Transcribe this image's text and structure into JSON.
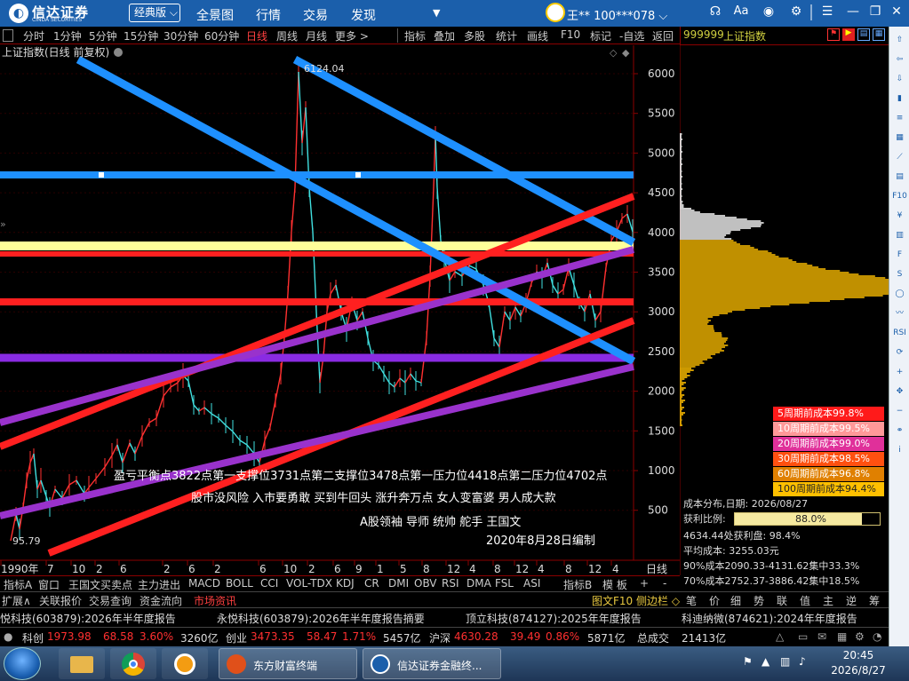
{
  "app": {
    "logo_text": "信达证券",
    "logo_en": "CINDA SECURITIES",
    "edition": "经典版",
    "menu": [
      "全景图",
      "行情",
      "交易",
      "发现"
    ],
    "user": "王** 100***078",
    "window_icons": [
      "headset-icon",
      "font-size-icon",
      "skin-icon",
      "settings-icon",
      "minimize-icon",
      "restore-icon",
      "close-icon"
    ]
  },
  "toolbar": {
    "periods": [
      "分时",
      "1分钟",
      "5分钟",
      "15分钟",
      "30分钟",
      "60分钟",
      "日线",
      "周线",
      "月线",
      "更多 >"
    ],
    "active_period": "日线",
    "tools": [
      "指标",
      "叠加",
      "多股",
      "统计",
      "画线",
      "F10",
      "标记",
      "-自选",
      "返回"
    ],
    "security_code": "999999",
    "security_name": "上证指数"
  },
  "chart": {
    "title": "上证指数(日线 前复权)",
    "high_label": "6124.04",
    "low_label": "95.79",
    "y_ticks": [
      500,
      1000,
      1500,
      2000,
      2500,
      3000,
      3500,
      4000,
      4500,
      5000,
      5500,
      6000
    ],
    "x_labels": [
      "1990年",
      "7",
      "10",
      "2",
      "6",
      "2",
      "6",
      "2",
      "6",
      "10",
      "2",
      "6",
      "9",
      "1",
      "5",
      "8",
      "12",
      "4",
      "8",
      "12",
      "4",
      "8",
      "12",
      "4"
    ],
    "period_label": "日线",
    "annotations": [
      "盈亏平衡点3822点第一支撑位3731点第二支撑位3478点第一压力位4418点第二压力位4702点",
      "股市没风险 入市要勇敢 买到牛回头 涨升奔万点 女人变富婆 男人成大款",
      "A股领袖 导师 统帅 舵手 王国文",
      "2020年8月28日编制"
    ],
    "h_lines": [
      {
        "value": 4702,
        "color": "#1e90ff"
      },
      {
        "value": 3822,
        "color": "#ffff99"
      },
      {
        "value": 3731,
        "color": "#ff2020"
      },
      {
        "value": 3100,
        "color": "#ff2020"
      },
      {
        "value": 2380,
        "color": "#8a2be2"
      }
    ],
    "colors": {
      "up": "#ff3030",
      "down": "#40e0e0",
      "blue_line": "#1e90ff",
      "red_line": "#ff2020",
      "purple_line": "#9932cc"
    }
  },
  "chip": {
    "cost_rows": [
      {
        "label": "5周期前成本99.8%",
        "color": "#ff1a1a"
      },
      {
        "label": "10周期前成本99.5%",
        "color": "#ff9999"
      },
      {
        "label": "20周期前成本99.0%",
        "color": "#e0309a"
      },
      {
        "label": "30周期前成本98.5%",
        "color": "#ff5010"
      },
      {
        "label": "60周期前成本96.8%",
        "color": "#e08000"
      },
      {
        "label": "100周期前成本94.4%",
        "color": "#ffc000"
      }
    ],
    "dist_date": "成本分布,日期:  2026/08/27",
    "profit_ratio_label": "获利比例:",
    "profit_ratio": "88.0%",
    "profit_ratio_fraction": 0.88,
    "profit_at": "4634.44处获利盘: 98.4%",
    "avg_cost": "平均成本:  3255.03元",
    "cost90": "90%成本2090.33-4131.62集中33.3%",
    "cost70": "70%成本2752.37-3886.42集中18.5%"
  },
  "indicators": [
    "指标A",
    "窗口",
    "王国文买卖点",
    "主力进出",
    "MACD",
    "BOLL",
    "CCI",
    "VOL-TDX",
    "KDJ",
    "CR",
    "DMI",
    "OBV",
    "RSI",
    "DMA",
    "FSL",
    "ASI",
    "指标B",
    "模 板",
    "+",
    "-"
  ],
  "bottom_tabs": [
    "扩展∧",
    "关联报价",
    "交易查询",
    "资金流向",
    "市场资讯"
  ],
  "bottom_right_tabs": [
    "图文F10",
    "侧边栏 ◇",
    "笔",
    "价",
    "细",
    "势",
    "联",
    "值",
    "主",
    "逆",
    "筹"
  ],
  "news": [
    "悦科技(603879):2026年半年度报告",
    "永悦科技(603879):2026年半年度报告摘要",
    "顶立科技(874127):2025年年度报告",
    "科迪纳微(874621):2024年年度报告"
  ],
  "ticker": {
    "items": [
      {
        "name": "科创",
        "value": "1973.98",
        "change": "68.58",
        "pct": "3.60%",
        "amount": "3260亿"
      },
      {
        "name": "创业",
        "value": "3473.35",
        "change": "58.47",
        "pct": "1.71%",
        "amount": "5457亿"
      },
      {
        "name": "沪深",
        "value": "4630.28",
        "change": "39.49",
        "pct": "0.86%",
        "amount": "5871亿"
      }
    ],
    "total_label": "总成交",
    "total": "21413亿"
  },
  "taskbar": {
    "apps": [
      "东方财富终端",
      "信达证券金融终..."
    ],
    "time": "20:45",
    "date": "2026/8/27"
  }
}
